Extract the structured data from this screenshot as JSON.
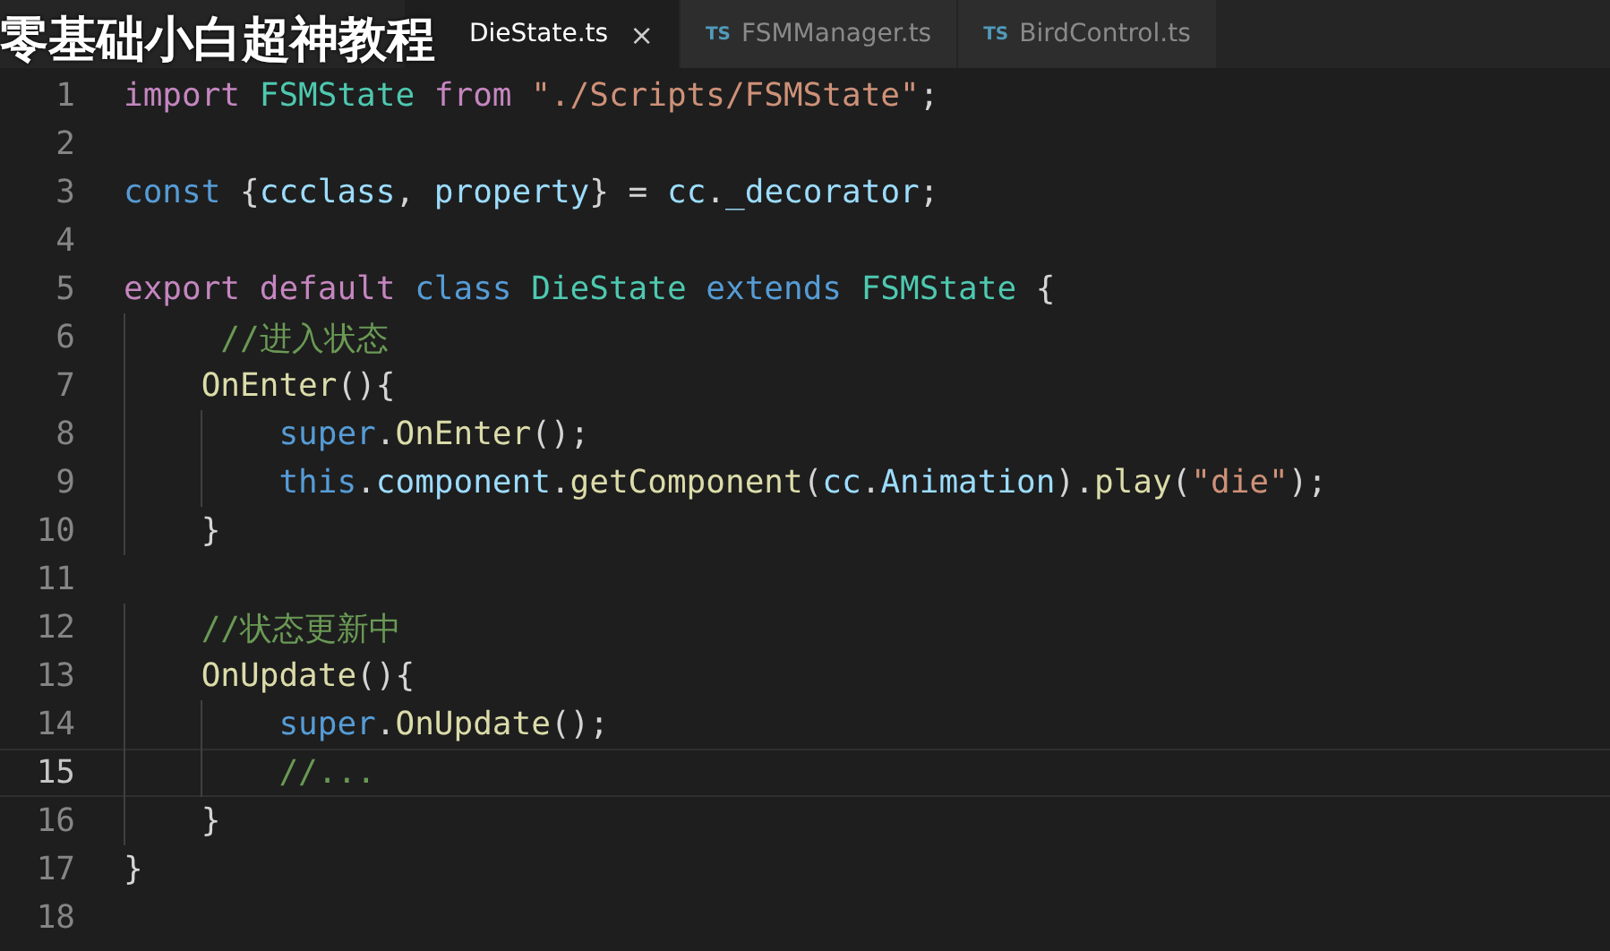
{
  "caption": "零基础小白超神教程",
  "tabs": [
    {
      "label": "DieState.ts",
      "selected": true,
      "close": "×"
    },
    {
      "badge": "TS",
      "label": "FSMManager.ts",
      "selected": false
    },
    {
      "badge": "TS",
      "label": "BirdControl.ts",
      "selected": false
    }
  ],
  "lines": [
    {
      "number": "1",
      "current": false,
      "tokens": [
        {
          "kind": "kw",
          "text": "import "
        },
        {
          "kind": "type",
          "text": "FSMState "
        },
        {
          "kind": "kw",
          "text": "from "
        },
        {
          "kind": "str",
          "text": "\"./Scripts/FSMState\""
        },
        {
          "kind": "plain",
          "text": ";"
        }
      ]
    },
    {
      "number": "2",
      "current": false
    },
    {
      "number": "3",
      "current": false,
      "tokens": [
        {
          "kind": "storage",
          "text": "const "
        },
        {
          "kind": "plain",
          "text": "{"
        },
        {
          "kind": "var",
          "text": "ccclass"
        },
        {
          "kind": "plain",
          "text": ", "
        },
        {
          "kind": "var",
          "text": "property"
        },
        {
          "kind": "plain",
          "text": "} = "
        },
        {
          "kind": "var",
          "text": "cc"
        },
        {
          "kind": "plain",
          "text": "."
        },
        {
          "kind": "var",
          "text": "_decorator"
        },
        {
          "kind": "plain",
          "text": ";"
        }
      ]
    },
    {
      "number": "4",
      "current": false
    },
    {
      "number": "5",
      "current": false,
      "tokens": [
        {
          "kind": "kw",
          "text": "export default "
        },
        {
          "kind": "storage",
          "text": "class "
        },
        {
          "kind": "type",
          "text": "DieState "
        },
        {
          "kind": "storage",
          "text": "extends "
        },
        {
          "kind": "type",
          "text": "FSMState "
        },
        {
          "kind": "plain",
          "text": "{"
        }
      ]
    },
    {
      "number": "6",
      "current": false,
      "tokens": [
        {
          "kind": "comment",
          "text": "     //进入状态"
        }
      ]
    },
    {
      "number": "7",
      "current": false,
      "tokens": [
        {
          "kind": "fn",
          "text": "    OnEnter"
        },
        {
          "kind": "plain",
          "text": "(){"
        }
      ]
    },
    {
      "number": "8",
      "current": false,
      "tokens": [
        {
          "kind": "storage",
          "text": "        super"
        },
        {
          "kind": "plain",
          "text": "."
        },
        {
          "kind": "fn",
          "text": "OnEnter"
        },
        {
          "kind": "plain",
          "text": "();"
        }
      ]
    },
    {
      "number": "9",
      "current": false,
      "tokens": [
        {
          "kind": "storage",
          "text": "        this"
        },
        {
          "kind": "plain",
          "text": "."
        },
        {
          "kind": "var",
          "text": "component"
        },
        {
          "kind": "plain",
          "text": "."
        },
        {
          "kind": "fn",
          "text": "getComponent"
        },
        {
          "kind": "plain",
          "text": "("
        },
        {
          "kind": "var",
          "text": "cc"
        },
        {
          "kind": "plain",
          "text": "."
        },
        {
          "kind": "var",
          "text": "Animation"
        },
        {
          "kind": "plain",
          "text": ")."
        },
        {
          "kind": "fn",
          "text": "play"
        },
        {
          "kind": "plain",
          "text": "("
        },
        {
          "kind": "str",
          "text": "\"die\""
        },
        {
          "kind": "plain",
          "text": ");"
        }
      ]
    },
    {
      "number": "10",
      "current": false,
      "tokens": [
        {
          "kind": "plain",
          "text": "    }"
        }
      ]
    },
    {
      "number": "11",
      "current": false
    },
    {
      "number": "12",
      "current": false,
      "tokens": [
        {
          "kind": "comment",
          "text": "    //状态更新中"
        }
      ]
    },
    {
      "number": "13",
      "current": false,
      "tokens": [
        {
          "kind": "fn",
          "text": "    OnUpdate"
        },
        {
          "kind": "plain",
          "text": "(){"
        }
      ]
    },
    {
      "number": "14",
      "current": false,
      "tokens": [
        {
          "kind": "storage",
          "text": "        super"
        },
        {
          "kind": "plain",
          "text": "."
        },
        {
          "kind": "fn",
          "text": "OnUpdate"
        },
        {
          "kind": "plain",
          "text": "();"
        }
      ]
    },
    {
      "number": "15",
      "current": true,
      "tokens": [
        {
          "kind": "comment",
          "text": "        //..."
        }
      ]
    },
    {
      "number": "16",
      "current": false,
      "tokens": [
        {
          "kind": "plain",
          "text": "    }"
        }
      ]
    },
    {
      "number": "17",
      "current": false,
      "tokens": [
        {
          "kind": "plain",
          "text": "}"
        }
      ]
    },
    {
      "number": "18",
      "current": false
    }
  ]
}
